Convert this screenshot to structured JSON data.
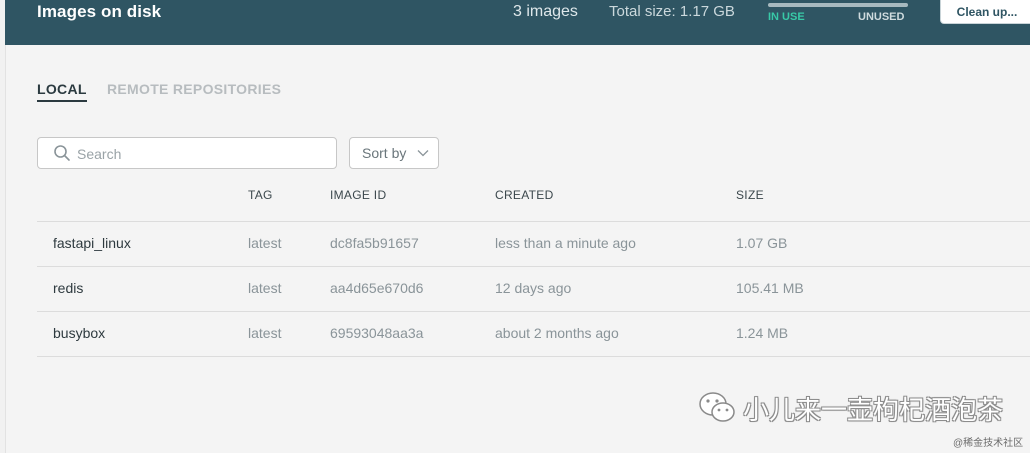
{
  "header": {
    "title": "Images on disk",
    "image_count": "3 images",
    "total_size": "Total size: 1.17 GB",
    "usage": {
      "in_use_label": "IN USE",
      "unused_label": "UNUSED",
      "in_use_fraction": 0.0,
      "accent": "#3fc5a6"
    },
    "cleanup_label": "Clean up..."
  },
  "tabs": [
    {
      "label": "LOCAL",
      "active": true
    },
    {
      "label": "REMOTE REPOSITORIES",
      "active": false
    }
  ],
  "search": {
    "placeholder": "Search",
    "value": ""
  },
  "sort": {
    "label": "Sort by"
  },
  "table": {
    "columns": [
      "",
      "TAG",
      "IMAGE ID",
      "CREATED",
      "SIZE"
    ],
    "rows": [
      {
        "name": "fastapi_linux",
        "tag": "latest",
        "image_id": "dc8fa5b91657",
        "created": "less than a minute ago",
        "size": "1.07 GB"
      },
      {
        "name": "redis",
        "tag": "latest",
        "image_id": "aa4d65e670d6",
        "created": "12 days ago",
        "size": "105.41 MB"
      },
      {
        "name": "busybox",
        "tag": "latest",
        "image_id": "69593048aa3a",
        "created": "about 2 months ago",
        "size": "1.24 MB"
      }
    ]
  },
  "watermark": {
    "text": "小儿来一壶枸杞酒泡茶",
    "source": "@稀金技术社区",
    "icon": "wechat-icon"
  }
}
